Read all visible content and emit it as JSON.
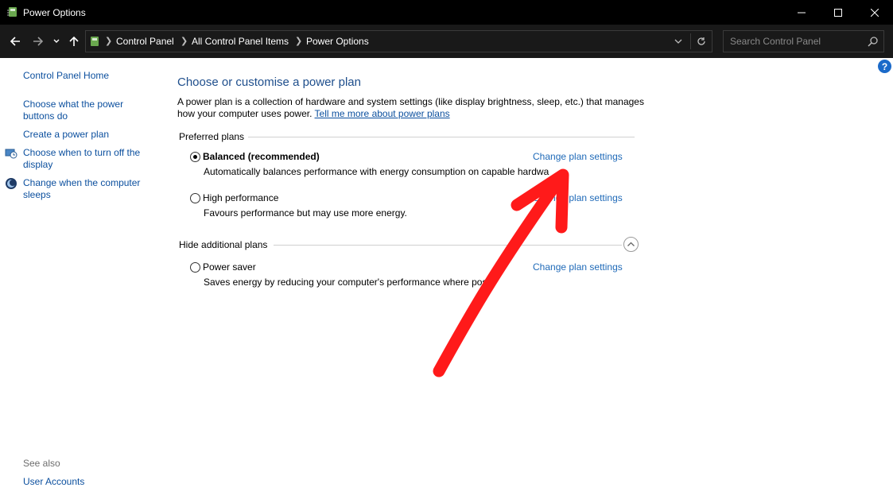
{
  "window": {
    "title": "Power Options",
    "minimize_icon": "minimize-icon",
    "maximize_icon": "maximize-icon",
    "close_icon": "close-icon"
  },
  "address_bar": {
    "breadcrumbs": [
      "Control Panel",
      "All Control Panel Items",
      "Power Options"
    ],
    "search_placeholder": "Search Control Panel"
  },
  "sidebar": {
    "home": "Control Panel Home",
    "links": [
      {
        "label_line1": "Choose what the power",
        "label_line2": "buttons do"
      },
      {
        "label_line1": "Create a power plan",
        "label_line2": ""
      },
      {
        "label_line1": "Choose when to turn off the",
        "label_line2": "display"
      },
      {
        "label_line1": "Change when the computer",
        "label_line2": "sleeps"
      }
    ],
    "see_also": "See also",
    "user_accounts": "User Accounts"
  },
  "main": {
    "heading": "Choose or customise a power plan",
    "description": "A power plan is a collection of hardware and system settings (like display brightness, sleep, etc.) that manages how your computer uses power.",
    "learn_more": "Tell me more about power plans",
    "preferred_label": "Preferred plans",
    "additional_label": "Hide additional plans",
    "change_label": "Change plan settings",
    "plans": [
      {
        "name": "Balanced (recommended)",
        "description": "Automatically balances performance with energy consumption on capable hardwa",
        "selected": true
      },
      {
        "name": "High performance",
        "description": "Favours performance but may use more energy.",
        "selected": false
      },
      {
        "name": "Power saver",
        "description": "Saves energy by reducing your computer's performance where poss",
        "selected": false
      }
    ]
  },
  "annotation": {
    "color": "#ff1a1a"
  }
}
